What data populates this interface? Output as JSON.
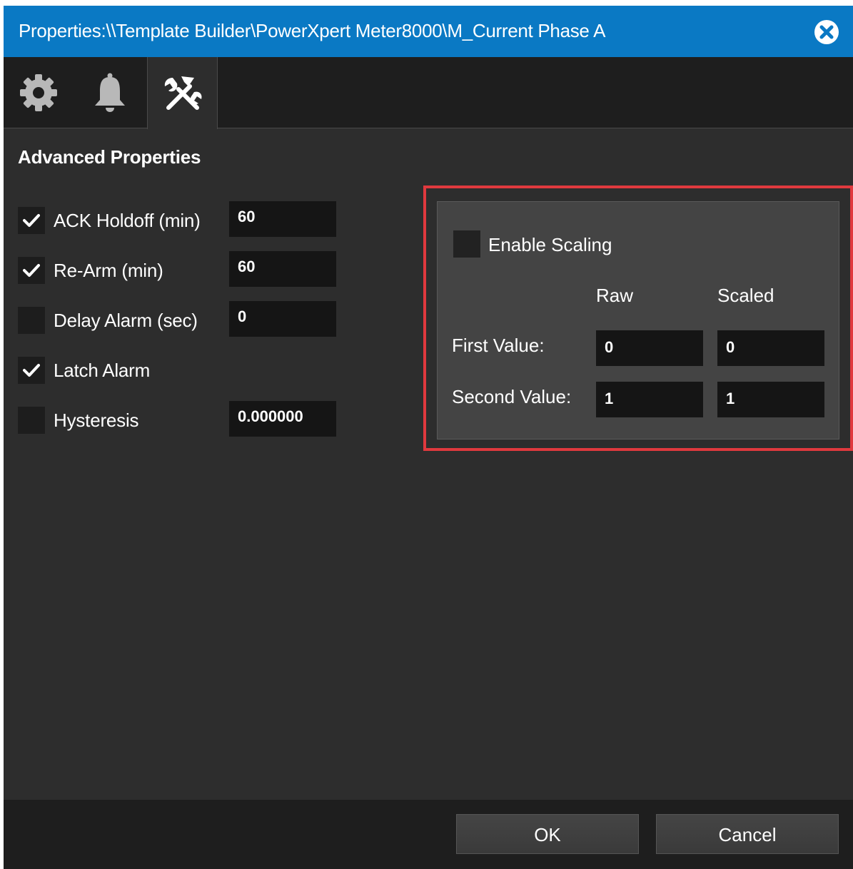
{
  "dialog": {
    "title": "Properties:\\\\Template Builder\\PowerXpert Meter8000\\M_Current Phase A"
  },
  "tabs": [
    {
      "icon": "gear-icon"
    },
    {
      "icon": "bell-icon"
    },
    {
      "icon": "tools-icon",
      "selected": true
    }
  ],
  "section_title": "Advanced Properties",
  "options": [
    {
      "label": "ACK Holdoff (min)",
      "checked": true,
      "value": "60"
    },
    {
      "label": "Re-Arm (min)",
      "checked": true,
      "value": "60"
    },
    {
      "label": "Delay Alarm (sec)",
      "checked": false,
      "value": "0"
    },
    {
      "label": "Latch Alarm",
      "checked": true
    },
    {
      "label": "Hysteresis",
      "checked": false,
      "value": "0.000000"
    }
  ],
  "scaling": {
    "enable_label": "Enable Scaling",
    "enabled": false,
    "col_raw": "Raw",
    "col_scaled": "Scaled",
    "first_label": "First Value:",
    "second_label": "Second Value:",
    "first_raw": "0",
    "first_scaled": "0",
    "second_raw": "1",
    "second_scaled": "1"
  },
  "buttons": {
    "ok": "OK",
    "cancel": "Cancel"
  },
  "colors": {
    "title_bar": "#0a79c4",
    "background": "#2d2d2d",
    "highlight": "#e0393e"
  }
}
